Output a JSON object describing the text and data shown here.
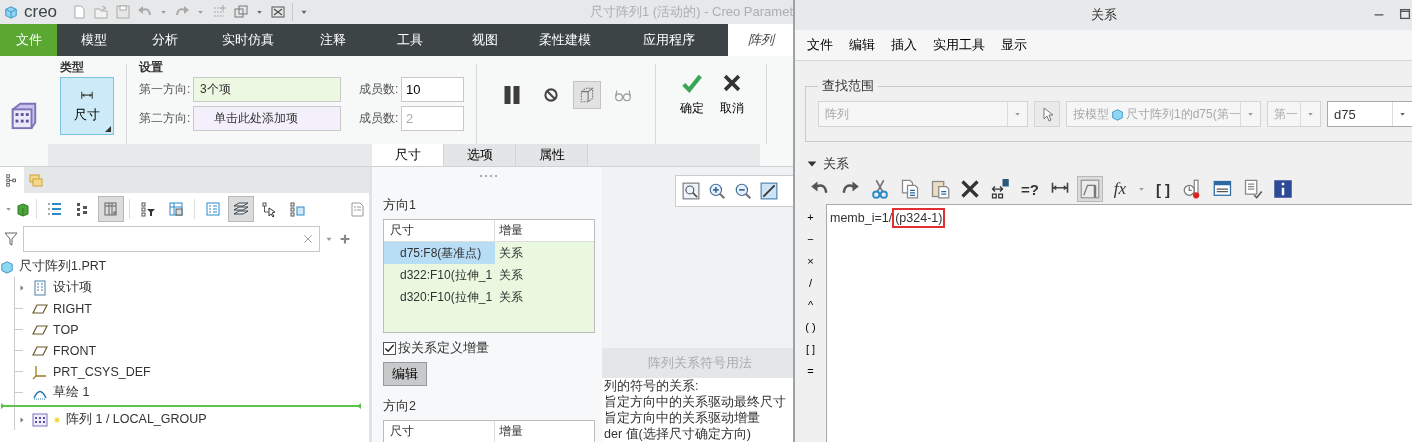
{
  "app": {
    "logo": "creo",
    "title": "尺寸阵列1 (活动的) - Creo Paramet"
  },
  "ribbon_tabs": [
    {
      "label": "文件",
      "kind": "file",
      "selected": false
    },
    {
      "label": "模型",
      "kind": "tab",
      "selected": false
    },
    {
      "label": "分析",
      "kind": "tab",
      "selected": false
    },
    {
      "label": "实时仿真",
      "kind": "tab",
      "selected": false
    },
    {
      "label": "注释",
      "kind": "tab",
      "selected": false
    },
    {
      "label": "工具",
      "kind": "tab",
      "selected": false
    },
    {
      "label": "视图",
      "kind": "tab",
      "selected": false
    },
    {
      "label": "柔性建模",
      "kind": "tab",
      "selected": false
    },
    {
      "label": "应用程序",
      "kind": "tab",
      "selected": false
    },
    {
      "label": "阵列",
      "kind": "contextual",
      "selected": true
    }
  ],
  "ribbon": {
    "type_group": {
      "title": "类型",
      "button": "尺寸",
      "selected": true
    },
    "settings": {
      "title": "设置",
      "rows": [
        {
          "label": "第一方向:",
          "value": "3个项",
          "filled": true,
          "count_label": "成员数:",
          "count": "10",
          "count_disabled": false
        },
        {
          "label": "第二方向:",
          "value": "单击此处添加项",
          "filled": false,
          "count_label": "成员数:",
          "count": "2",
          "count_disabled": true
        }
      ]
    },
    "options": [
      {
        "kind": "pause",
        "pressed": false
      },
      {
        "kind": "no-entry",
        "pressed": false
      },
      {
        "kind": "preview",
        "pressed": true
      },
      {
        "kind": "glasses",
        "pressed": false
      }
    ],
    "confirm": "确定",
    "cancel": "取消"
  },
  "dash_tabs": [
    {
      "label": "尺寸",
      "selected": true
    },
    {
      "label": "选项",
      "selected": false
    },
    {
      "label": "属性",
      "selected": false
    }
  ],
  "model_tree": {
    "toolbar": [
      {
        "kind": "list-expand",
        "pressed": false
      },
      {
        "kind": "list-collapse",
        "pressed": false
      },
      {
        "kind": "columns",
        "pressed": true
      },
      {
        "kind": "filter",
        "pressed": false
      },
      {
        "kind": "tree-columns",
        "pressed": false
      },
      {
        "kind": "details",
        "pressed": false
      },
      {
        "kind": "layers",
        "pressed": true
      },
      {
        "kind": "select-tree",
        "pressed": false
      },
      {
        "kind": "subtree",
        "pressed": false
      }
    ],
    "root": {
      "label": "尺寸阵列1.PRT",
      "children": [
        {
          "label": "设计项",
          "kind": "items",
          "expanded": false
        },
        {
          "label": "RIGHT",
          "kind": "plane"
        },
        {
          "label": "TOP",
          "kind": "plane"
        },
        {
          "label": "FRONT",
          "kind": "plane"
        },
        {
          "label": "PRT_CSYS_DEF",
          "kind": "csys"
        },
        {
          "label": "草绘 1",
          "kind": "sketch"
        },
        {
          "label": "阵列 1 / LOCAL_GROUP",
          "kind": "pattern",
          "expanded": false
        }
      ]
    }
  },
  "pattern_panel": {
    "direction1": {
      "title": "方向1",
      "columns": [
        "尺寸",
        "增量"
      ],
      "rows": [
        {
          "dimension": "d75:F8(基准点)",
          "increment": "关系",
          "selected": true
        },
        {
          "dimension": "d322:F10(拉伸_1",
          "increment": "关系",
          "selected": false
        },
        {
          "dimension": "d320:F10(拉伸_1",
          "increment": "关系",
          "selected": false
        }
      ]
    },
    "relation_checkbox": {
      "label": "按关系定义增量",
      "checked": true
    },
    "edit_button": "编辑",
    "direction2": {
      "title": "方向2",
      "columns": [
        "尺寸",
        "增量"
      ]
    }
  },
  "help_panel": {
    "title": "阵列关系符号用法",
    "lines": [
      "列的符号的关系:",
      "旨定方向中的关系驱动最终尺寸",
      "旨定方向中的关系驱动增量",
      "der 值(选择尺寸确定方向)"
    ]
  },
  "relations_dialog": {
    "title": "关系",
    "menu": [
      "文件",
      "编辑",
      "插入",
      "实用工具",
      "显示"
    ],
    "find_scope": {
      "legend": "查找范围",
      "type": {
        "value": "阵列",
        "disabled": true
      },
      "model": {
        "prefix": "按模型",
        "value": "尺寸阵列1的d75(第一",
        "disabled": true
      },
      "direction": {
        "value": "第一",
        "disabled": true
      },
      "parameter": {
        "value": "d75",
        "disabled": false
      }
    },
    "section": {
      "title": "关系",
      "expanded": true
    },
    "toolbar": [
      {
        "kind": "undo",
        "pressed": false
      },
      {
        "kind": "redo",
        "pressed": false
      },
      {
        "kind": "cut",
        "pressed": false
      },
      {
        "kind": "copy",
        "pressed": false
      },
      {
        "kind": "paste",
        "pressed": false
      },
      {
        "kind": "delete",
        "pressed": false
      },
      {
        "kind": "dim-values",
        "pressed": false
      },
      {
        "kind": "glyph",
        "glyph": "=?",
        "pressed": false
      },
      {
        "kind": "dimension",
        "pressed": false
      },
      {
        "kind": "table",
        "pressed": true
      },
      {
        "kind": "function",
        "glyph": "fx",
        "pressed": false
      },
      {
        "kind": "glyph",
        "glyph": "[ ]",
        "pressed": false
      },
      {
        "kind": "sensitivity",
        "pressed": false
      },
      {
        "kind": "sort",
        "pressed": false
      },
      {
        "kind": "verify",
        "pressed": false
      },
      {
        "kind": "info",
        "pressed": false
      }
    ],
    "operators": [
      "+",
      "−",
      "×",
      "/",
      "^",
      "( )",
      "[ ]",
      "="
    ],
    "code": {
      "text": "memb_i=1/",
      "highlighted": "(p324-1)"
    }
  }
}
